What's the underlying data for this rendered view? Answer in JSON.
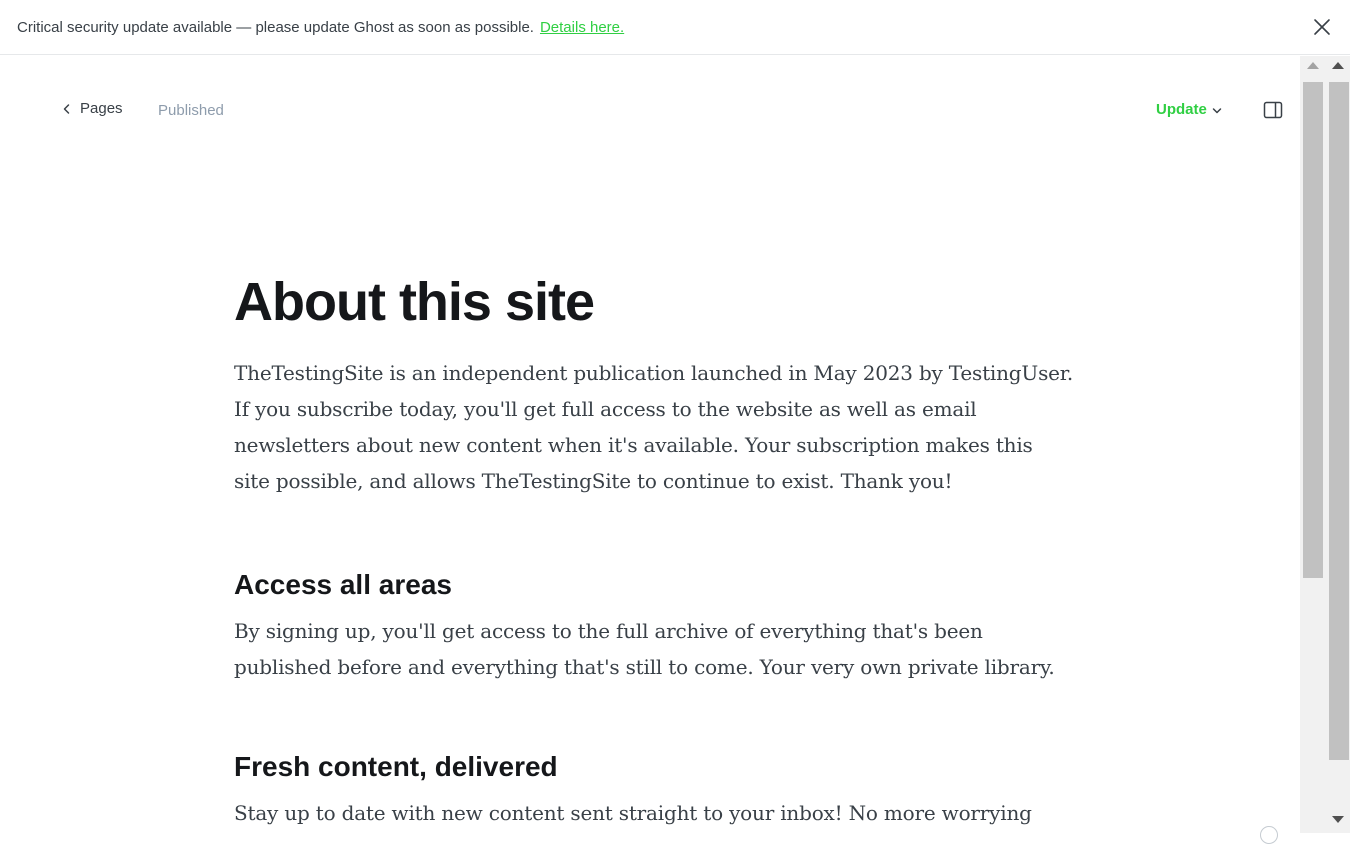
{
  "banner": {
    "message": "Critical security update available — please update Ghost as soon as possible.",
    "link_label": "Details here.",
    "close_icon": "close-icon"
  },
  "header": {
    "back_label": "Pages",
    "status": "Published",
    "update_label": "Update",
    "sidebar_icon": "sidebar-toggle-icon"
  },
  "article": {
    "title": "About this site",
    "intro": "TheTestingSite is an independent publication launched in May 2023 by TestingUser. If you subscribe today, you'll get full access to the website as well as email newsletters about new content when it's available. Your subscription makes this site possible, and allows TheTestingSite to continue to exist. Thank you!",
    "sections": [
      {
        "heading": "Access all areas",
        "body": "By signing up, you'll get access to the full archive of everything that's been published before and everything that's still to come. Your very own private library."
      },
      {
        "heading": "Fresh content, delivered",
        "body": "Stay up to date with new content sent straight to your inbox! No more worrying about whether you missed something because of a pesky algorithm or news feed."
      }
    ]
  },
  "colors": {
    "accent": "#30cf43",
    "text": "#15171a",
    "muted": "#8e9cac"
  }
}
